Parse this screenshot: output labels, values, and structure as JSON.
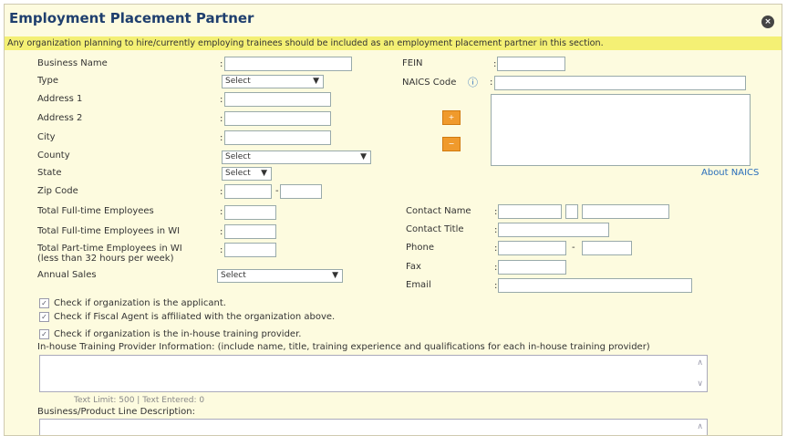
{
  "header": {
    "title": "Employment Placement Partner",
    "close_glyph": "×",
    "notice": "Any organization planning to hire/currently employing trainees should be included as an employment placement partner in this section."
  },
  "left": {
    "business_name": "Business Name",
    "type": "Type",
    "type_value": "Select",
    "address1": "Address 1",
    "address2": "Address 2",
    "city": "City",
    "county": "County",
    "county_value": "Select",
    "state": "State",
    "state_value": "Select",
    "zip": "Zip Code",
    "total_ft": "Total Full-time Employees",
    "total_ft_wi": "Total Full-time Employees in WI",
    "total_pt_wi_1": "Total Part-time Employees in WI",
    "total_pt_wi_2": "(less than 32 hours per week)",
    "annual_sales": "Annual Sales",
    "annual_sales_value": "Select"
  },
  "right": {
    "fein": "FEIN",
    "naics": "NAICS Code",
    "about_naics": "About NAICS",
    "add_btn": "+",
    "remove_btn": "−",
    "contact_name": "Contact Name",
    "contact_title": "Contact Title",
    "phone": "Phone",
    "fax": "Fax",
    "email": "Email"
  },
  "checks": [
    {
      "label": "Check if organization is the applicant.",
      "checked": true
    },
    {
      "label": "Check if Fiscal Agent is affiliated with the organization above.",
      "checked": true
    },
    {
      "label": "Check if organization is the in-house training provider.",
      "checked": true
    }
  ],
  "inhouse": {
    "label": "In-house Training Provider Information: (include name, title, training experience and qualifications for each in-house training provider)",
    "limit": "Text Limit: 500 | Text Entered: 0"
  },
  "business_desc": {
    "label": "Business/Product Line Description:"
  },
  "glyphs": {
    "colon": ":",
    "dash": "-",
    "arrow_down": "▼",
    "arrow_up": "∧",
    "arrow_dn": "∨",
    "check": "✓",
    "info": "ⓘ"
  }
}
